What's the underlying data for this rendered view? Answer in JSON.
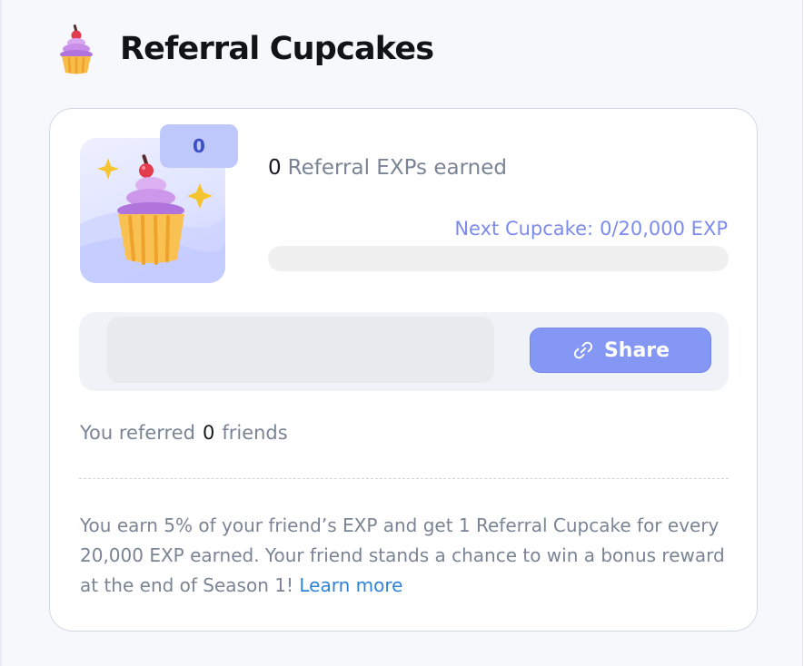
{
  "header": {
    "title": "Referral Cupcakes",
    "icon": "cupcake-icon"
  },
  "card": {
    "cupcake_count": "0",
    "exp_earned_value": "0",
    "exp_earned_label": "Referral EXPs earned",
    "next_cupcake_label": "Next Cupcake:",
    "next_cupcake_value": "0/20,000 EXP",
    "progress_fraction": 0,
    "referral_link_value": "",
    "share_label": "Share",
    "share_icon": "link-icon",
    "referred_prefix": "You referred",
    "referred_count": "0",
    "referred_suffix": "friends",
    "info_text": "You earn 5% of your friend’s EXP and get 1 Referral Cupcake for every 20,000 EXP earned. Your friend stands a chance to win a bonus reward at the end of Season 1!",
    "learn_more": "Learn more"
  },
  "colors": {
    "accent": "#8497f4",
    "badge": "#bfc8fb",
    "badge_text": "#3d4fc4",
    "link": "#2f84d8",
    "muted_text": "#7a8494"
  }
}
